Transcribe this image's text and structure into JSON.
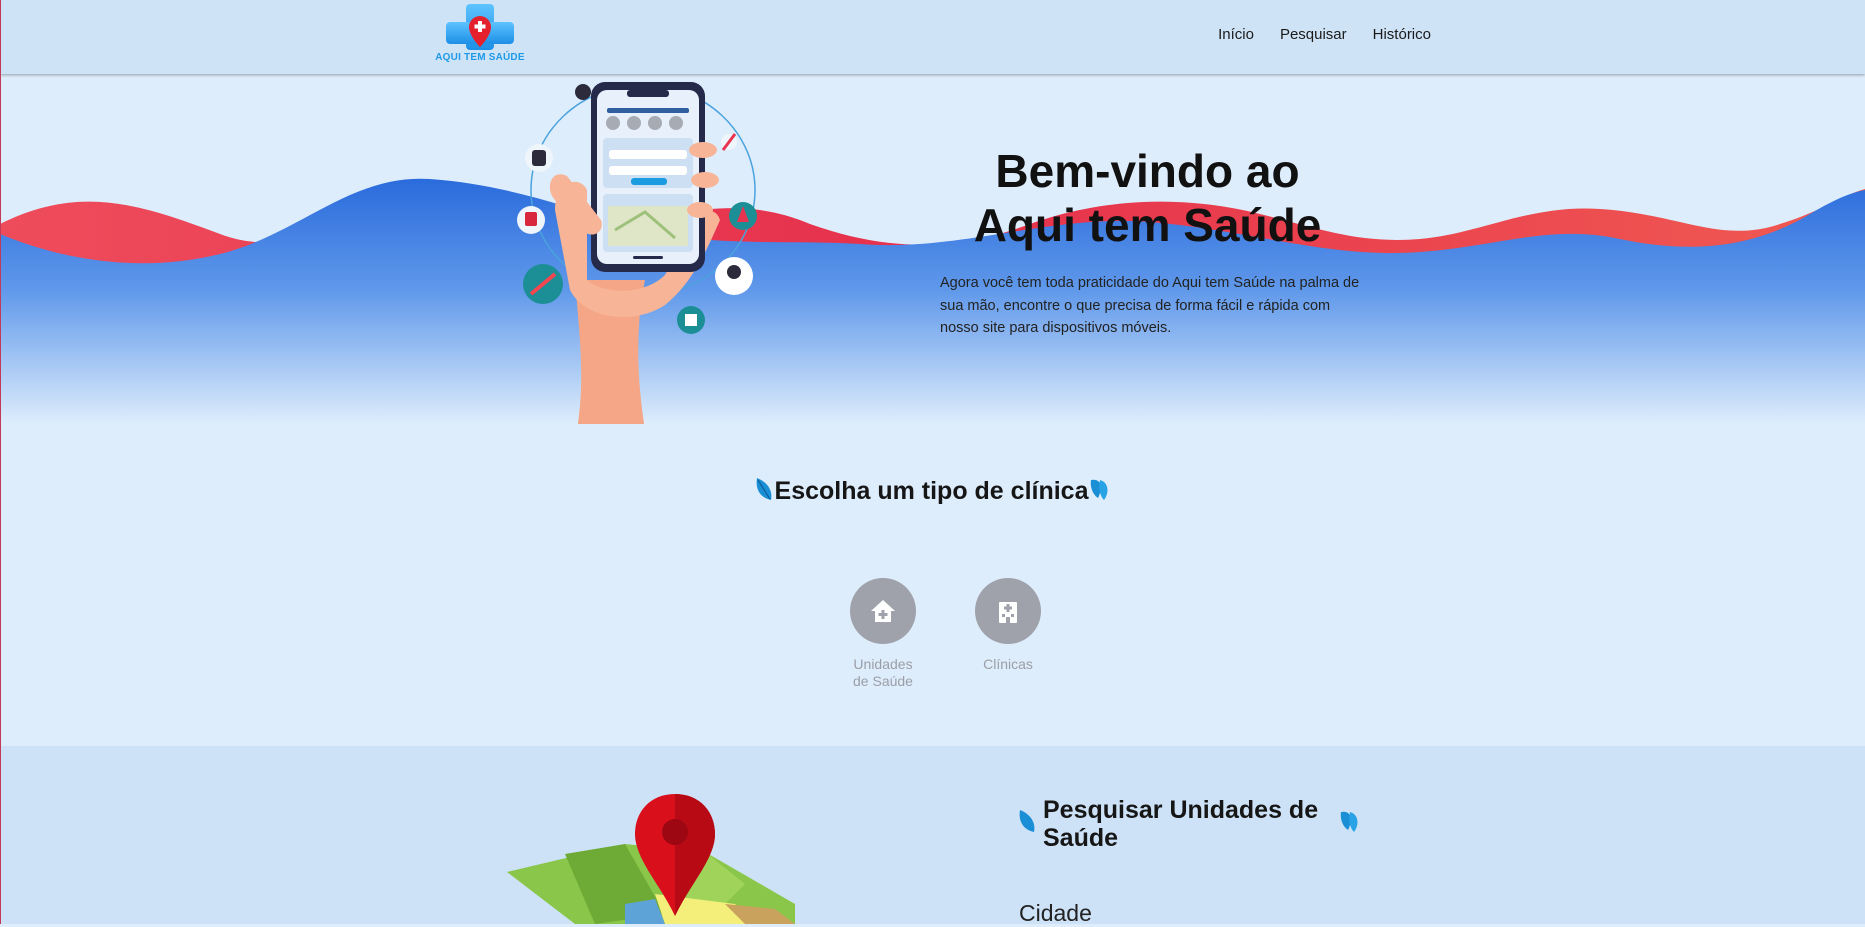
{
  "brand": {
    "logo_text": "AQUI TEM SAÚDE"
  },
  "nav": {
    "items": [
      "Início",
      "Pesquisar",
      "Histórico"
    ]
  },
  "hero": {
    "title_line1": "Bem-vindo ao",
    "title_line2": "Aqui tem Saúde",
    "description": "Agora você tem toda praticidade do Aqui tem Saúde na palma de sua mão, encontre o que precisa de forma fácil e rápida com nosso site para dispositivos móveis."
  },
  "clinic_section": {
    "title": "Escolha um tipo de clínica",
    "options": [
      {
        "label_line1": "Unidades",
        "label_line2": "de Saúde",
        "icon": "home-plus-icon"
      },
      {
        "label_line1": "Clínicas",
        "label_line2": "",
        "icon": "hospital-building-icon"
      }
    ]
  },
  "search_section": {
    "title_line1": "Pesquisar Unidades de",
    "title_line2": "Saúde",
    "city_label": "Cidade"
  },
  "colors": {
    "navbar": "#cfe3f7",
    "background": "#deedfc",
    "wave_red": "#e8344e",
    "wave_blue": "#2f72dc",
    "icon_gray": "#9fa2ab",
    "brand_blue": "#1e9ae6",
    "pin_red": "#d90f1c"
  }
}
